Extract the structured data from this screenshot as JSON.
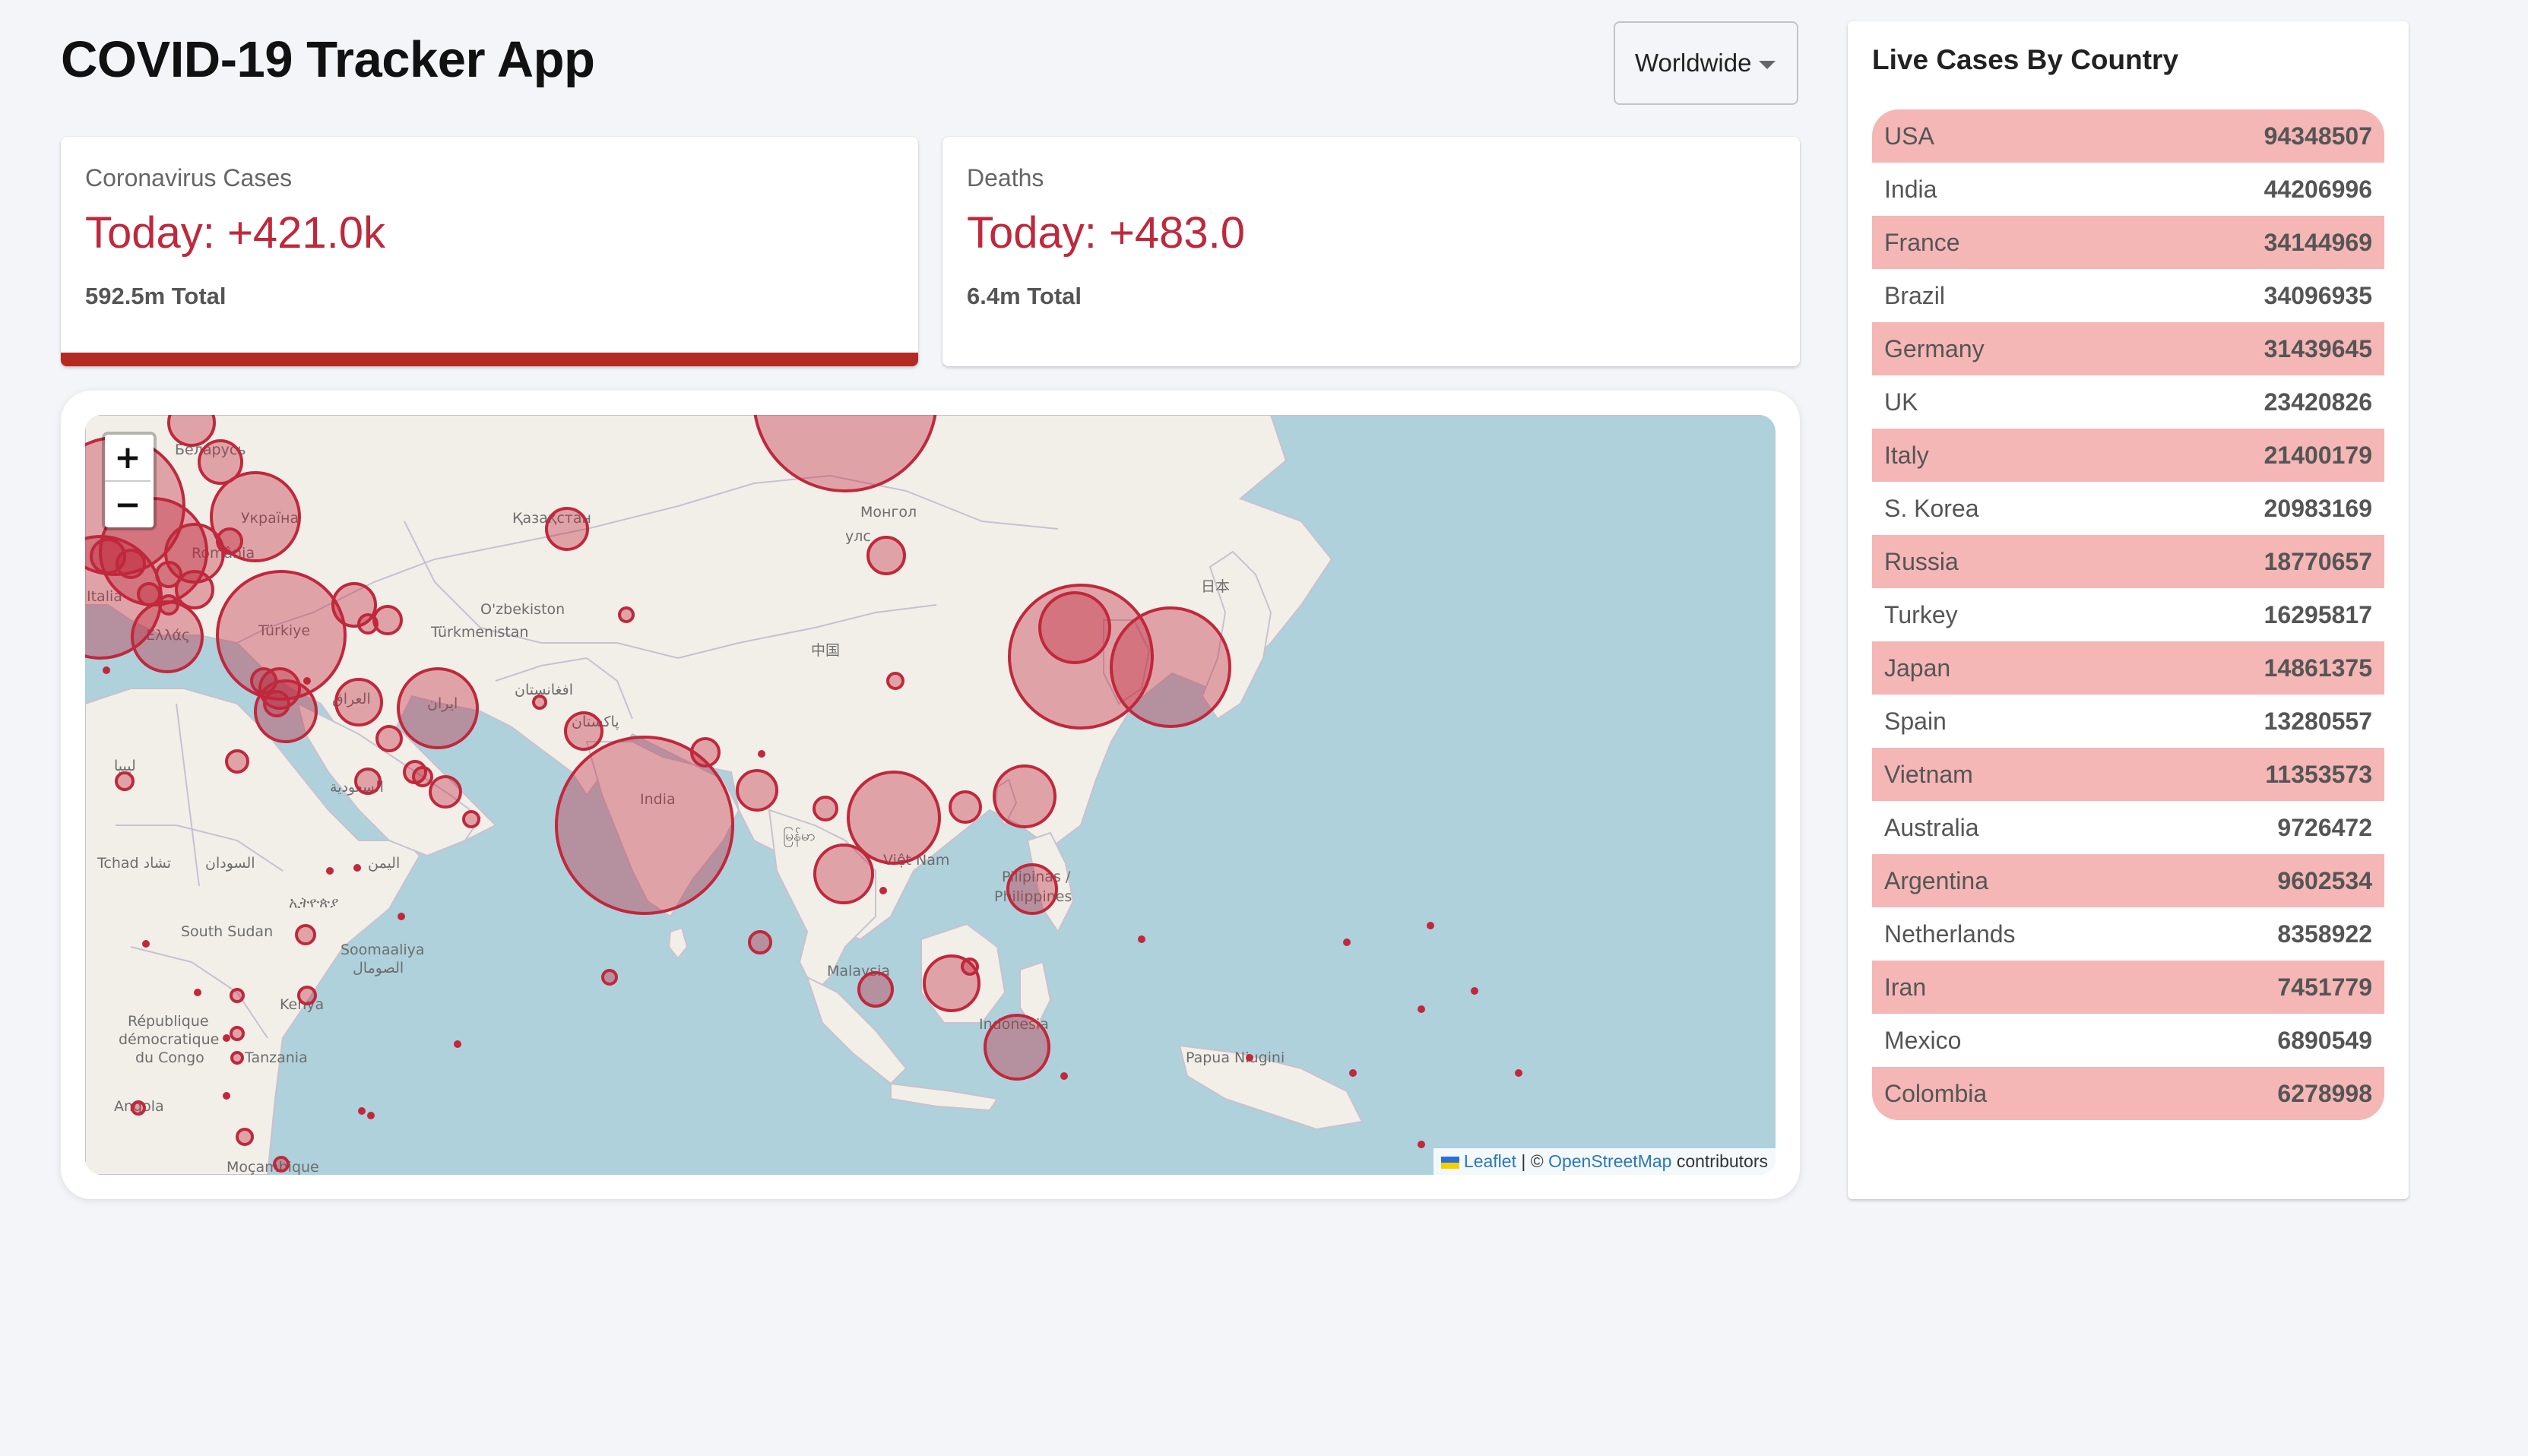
{
  "app": {
    "title": "COVID-19 Tracker App"
  },
  "country_select": {
    "selected": "Worldwide"
  },
  "cards": {
    "cases": {
      "label": "Coronavirus Cases",
      "today": "Today: +421.0k",
      "total": "592.5m Total",
      "active": true
    },
    "deaths": {
      "label": "Deaths",
      "today": "Today: +483.0",
      "total": "6.4m Total",
      "active": false
    }
  },
  "map": {
    "zoom_in": "+",
    "zoom_out": "−",
    "attribution": {
      "leaflet": "Leaflet",
      "separator": " | © ",
      "osm": "OpenStreetMap",
      "contributors": " contributors"
    },
    "circle_color": "#c0283c",
    "place_labels": {
      "belarus": "Беларусь",
      "ukraine": "Україна",
      "kazakhstan": "Қазақстан",
      "mongolia": "Монгол",
      "mongolia2": "улс",
      "romania": "România",
      "uzbekistan": "O'zbekiston",
      "turkmenistan": "Türkmenistan",
      "china": "中国",
      "japan": "日本",
      "italy": "Italia",
      "greece": "Ελλάς",
      "turkiye": "Türkiye",
      "iraq": "العراق",
      "iran": "ایران",
      "afghanistan": "افغانستان",
      "pakistan": "پاکستان",
      "saudi": "السعودية",
      "libya": "ليبيا",
      "india": "India",
      "myanmar": "မြန်မာ",
      "vietnam": "Việt Nam",
      "philippines": "Pilipinas /",
      "philippines2": "Philippines",
      "chad": "Tchad تشاد",
      "sudan": "السودان",
      "yemen": "اليمن",
      "south_sudan": "South Sudan",
      "somalia": "Soomaaliya",
      "somalia2": "الصومال",
      "ethiopia": "ኢትዮጵያ",
      "drc": "République",
      "drc2": "démocratique",
      "drc3": "du Congo",
      "kenya": "Kenya",
      "tanzania": "Tanzania",
      "malaysia": "Malaysia",
      "indonesia": "Indonesia",
      "png": "Papua Niugini",
      "angola": "Angola",
      "mozambique": "Moçambique"
    }
  },
  "live_cases": {
    "title": "Live Cases By Country",
    "rows": [
      {
        "country": "USA",
        "cases": "94348507"
      },
      {
        "country": "India",
        "cases": "44206996"
      },
      {
        "country": "France",
        "cases": "34144969"
      },
      {
        "country": "Brazil",
        "cases": "34096935"
      },
      {
        "country": "Germany",
        "cases": "31439645"
      },
      {
        "country": "UK",
        "cases": "23420826"
      },
      {
        "country": "Italy",
        "cases": "21400179"
      },
      {
        "country": "S. Korea",
        "cases": "20983169"
      },
      {
        "country": "Russia",
        "cases": "18770657"
      },
      {
        "country": "Turkey",
        "cases": "16295817"
      },
      {
        "country": "Japan",
        "cases": "14861375"
      },
      {
        "country": "Spain",
        "cases": "13280557"
      },
      {
        "country": "Vietnam",
        "cases": "11353573"
      },
      {
        "country": "Australia",
        "cases": "9726472"
      },
      {
        "country": "Argentina",
        "cases": "9602534"
      },
      {
        "country": "Netherlands",
        "cases": "8358922"
      },
      {
        "country": "Iran",
        "cases": "7451779"
      },
      {
        "country": "Mexico",
        "cases": "6890549"
      },
      {
        "country": "Colombia",
        "cases": "6278998"
      }
    ]
  }
}
